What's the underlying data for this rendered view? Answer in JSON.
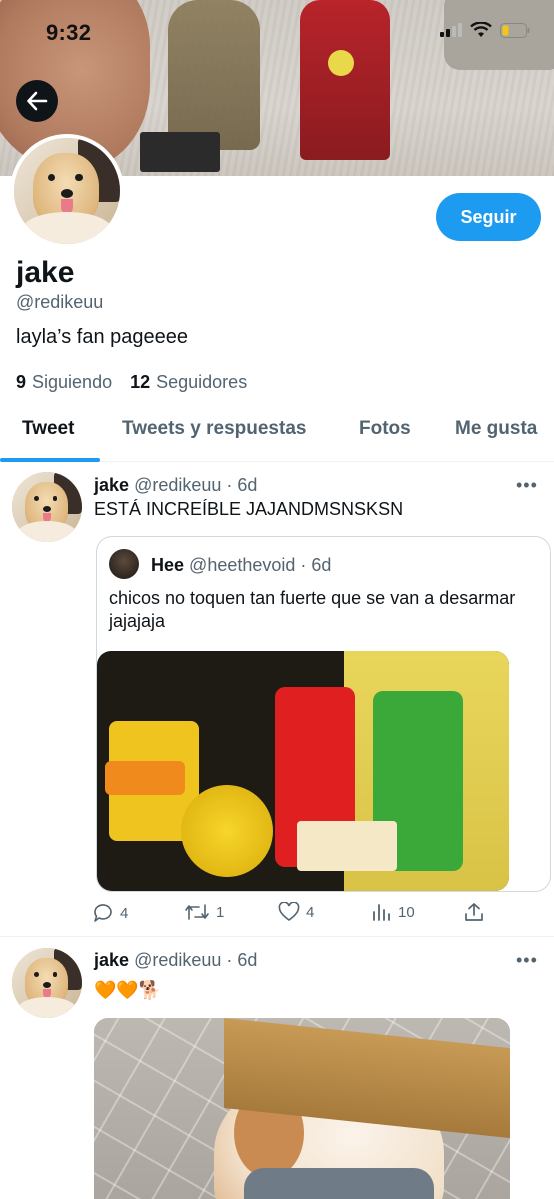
{
  "status_bar": {
    "time": "9:32"
  },
  "profile": {
    "name": "jake",
    "handle": "@redikeuu",
    "bio": "layla’s fan pageeee",
    "follow_label": "Seguir",
    "following_count": "9",
    "following_label": "Siguiendo",
    "followers_count": "12",
    "followers_label": "Seguidores"
  },
  "tabs": [
    {
      "label": "Tweet",
      "active": true
    },
    {
      "label": "Tweets y respuestas",
      "active": false
    },
    {
      "label": "Fotos",
      "active": false
    },
    {
      "label": "Me gusta",
      "active": false
    }
  ],
  "tweets": [
    {
      "name": "jake",
      "handle": "@redikeuu",
      "time": "· 6d",
      "text": "ESTÁ INCREÍBLE JAJANDMSNSKSN",
      "quote": {
        "name": "Hee",
        "handle": "@heethevoid",
        "time": "· 6d",
        "text": "chicos no toquen tan fuerte que se van a desarmar jajajaja"
      },
      "stats": {
        "replies": "4",
        "retweets": "1",
        "likes": "4",
        "views": "10"
      }
    },
    {
      "name": "jake",
      "handle": "@redikeuu",
      "time": "· 6d",
      "text": "🧡🧡🐕"
    }
  ],
  "colors": {
    "accent": "#1d9bf0",
    "text": "#0f1419",
    "muted": "#536471"
  }
}
